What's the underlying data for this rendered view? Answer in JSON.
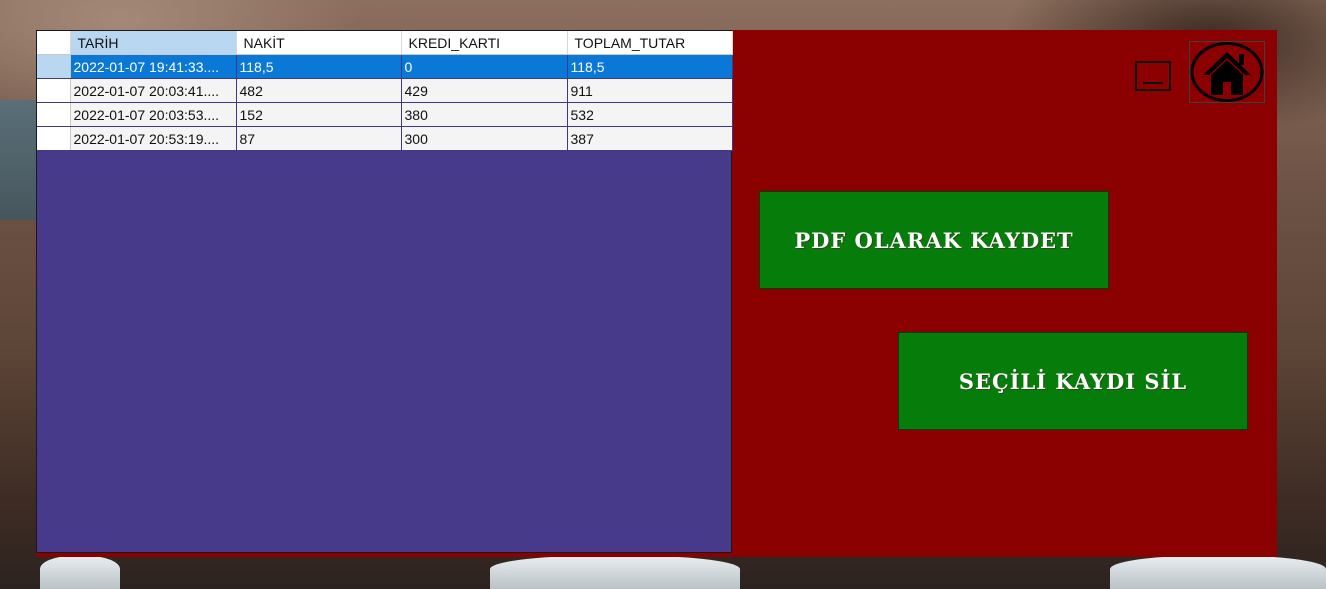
{
  "grid": {
    "columns": [
      "TARİH",
      "NAKİT",
      "KREDI_KARTI",
      "TOPLAM_TUTAR"
    ],
    "sorted_column_index": 0,
    "selected_row_index": 0,
    "rows": [
      [
        "2022-01-07 19:41:33....",
        "118,5",
        "0",
        "118,5"
      ],
      [
        "2022-01-07 20:03:41....",
        "482",
        "429",
        "911"
      ],
      [
        "2022-01-07 20:03:53....",
        "152",
        "380",
        "532"
      ],
      [
        "2022-01-07 20:53:19....",
        "87",
        "300",
        "387"
      ]
    ]
  },
  "buttons": {
    "pdf_label": "PDF OLARAK KAYDET",
    "delete_label": "SEÇİLİ KAYDI SİL"
  },
  "icons": {
    "minimize": "minimize-icon",
    "home": "home-icon"
  },
  "colors": {
    "window_background": "#8b0000",
    "grid_background": "#483a8a",
    "button_green": "#067d0b",
    "selection_blue": "#0a78d7",
    "sorted_header": "#b9d7f1"
  }
}
